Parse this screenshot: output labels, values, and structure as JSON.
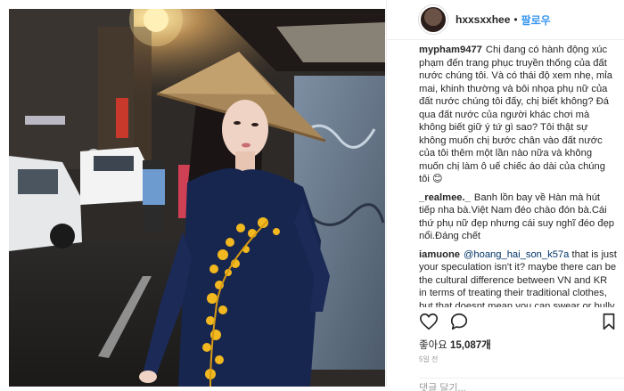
{
  "header": {
    "username": "hxxsxxhee",
    "separator": "•",
    "follow_label": "팔로우"
  },
  "comments": [
    {
      "author": "mypham9477",
      "text": "Chị đang có hành động xúc phạm đến trang phục truyền thống của đất nước chúng tôi. Và có thái độ xem nhẹ, mỉa mai, khinh thường và bôi nhọa phụ nữ của đất nước chúng tôi đấy, chị biết không? Đá qua đất nước của người khác chơi mà không biết giữ ý tứ gì sao? Tôi thật sự không muốn chị bước chân vào đất nước của tôi thêm một lần nào nữa và không muốn chị làm ô uế chiếc áo dài của chúng tôi 😊"
    },
    {
      "author": "_realmee._",
      "text": "Banh lồn bay về Hàn mà hút tiếp nha bà.Việt Nam đéo chào đón bà.Cái thứ phụ nữ đẹp nhưng cái suy nghĩ đéo đẹp nổi.Đáng chết"
    },
    {
      "author": "iamuone",
      "mention": "@hoang_hai_son_k57a",
      "text": "that is just your speculation isn't it? maybe there can be the cultural difference between VN and KR in terms of treating their traditional clothes, but that doesnt mean you can swear or bully her."
    }
  ],
  "likes": {
    "label": "좋아요",
    "count": "15,087개"
  },
  "time": "5일 전",
  "add_comment_placeholder": "댓글 달기...",
  "colors": {
    "link": "#3897f0",
    "mention": "#003569",
    "dress": "#17264f",
    "embroidery": "#f2b81f"
  },
  "icons": [
    "heart-icon",
    "comment-icon",
    "bookmark-icon"
  ]
}
